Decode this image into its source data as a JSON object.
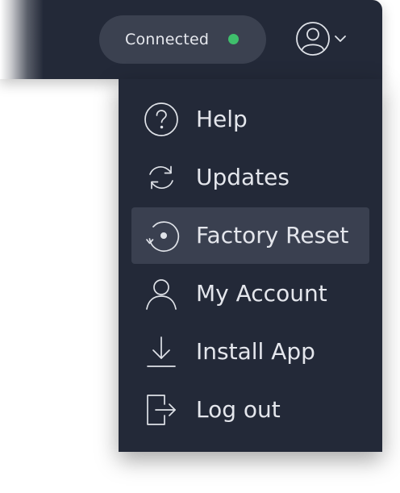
{
  "header": {
    "status": {
      "label": "Connected",
      "indicator_color": "#3fbf6c"
    },
    "account_menu": {
      "icon": "user-circle-icon",
      "caret_icon": "chevron-down-icon",
      "expanded": true
    }
  },
  "menu": {
    "items": [
      {
        "label": "Help",
        "icon": "help-circle-icon",
        "active": false
      },
      {
        "label": "Updates",
        "icon": "refresh-icon",
        "active": false
      },
      {
        "label": "Factory Reset",
        "icon": "factory-reset-icon",
        "active": true
      },
      {
        "label": "My Account",
        "icon": "user-icon",
        "active": false
      },
      {
        "label": "Install App",
        "icon": "download-icon",
        "active": false
      },
      {
        "label": "Log out",
        "icon": "logout-icon",
        "active": false
      }
    ]
  },
  "colors": {
    "background_dark": "#232938",
    "pill": "#3b4150",
    "active_item": "#3a4050",
    "text": "#e4e6ec",
    "icon_stroke": "#dfe2e8"
  }
}
